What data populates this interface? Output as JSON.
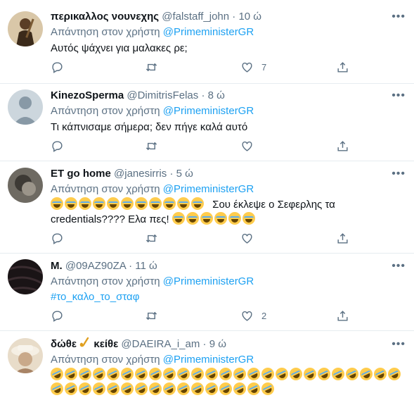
{
  "tweets": [
    {
      "name": "περικαλλος νουνεχης",
      "handle": "@falstaff_john",
      "time": "10 ώ",
      "reply_prefix": "Απάντηση στον χρήστη",
      "reply_to": "@PrimeministerGR",
      "text": "Αυτός ψάχνει για μαλακες ρε;",
      "likes": "7",
      "retweets": "",
      "replies": ""
    },
    {
      "name": "KinezoSperma",
      "handle": "@DimitrisFelas",
      "time": "8 ώ",
      "reply_prefix": "Απάντηση στον χρήστη",
      "reply_to": "@PrimeministerGR",
      "text": "Τι κάπνισαμε σήμερα; δεν πήγε καλά αυτό",
      "likes": "",
      "retweets": "",
      "replies": ""
    },
    {
      "name": "ET go home",
      "handle": "@janesirris",
      "time": "5 ώ",
      "reply_prefix": "Απάντηση στον χρήστη",
      "reply_to": "@PrimeministerGR",
      "text_line1": "Σου έκλεψε ο Σεφερλης τα",
      "text_line2": "credentials???? Ελα πες!",
      "likes": "",
      "retweets": "",
      "replies": ""
    },
    {
      "name": "M.",
      "handle": "@09AZ90ZA",
      "time": "11 ώ",
      "reply_prefix": "Απάντηση στον χρήστη",
      "reply_to": "@PrimeministerGR",
      "hashtag": "#το_καλο_το_σταφ",
      "likes": "2",
      "retweets": "",
      "replies": ""
    },
    {
      "name": "δώθε",
      "name_suffix": "κείθε",
      "handle": "@DAEIRA_i_am",
      "time": "9 ώ",
      "reply_prefix": "Απάντηση στον χρήστη",
      "reply_to": "@PrimeministerGR"
    }
  ],
  "dot": "·",
  "more_icon": "more-icon",
  "colors": {
    "link": "#1da1f2",
    "muted": "#5b7083",
    "border": "#e6ecf0",
    "emoji": "#ffcc4d"
  }
}
